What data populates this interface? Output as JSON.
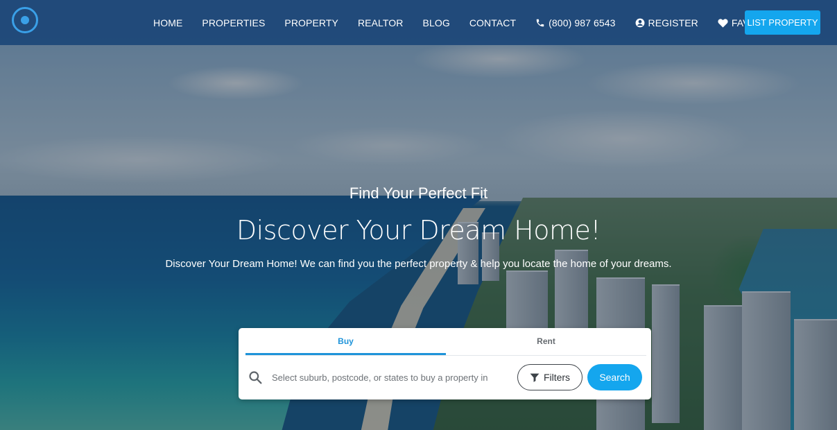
{
  "nav": {
    "items": [
      {
        "label": "HOME"
      },
      {
        "label": "PROPERTIES"
      },
      {
        "label": "PROPERTY"
      },
      {
        "label": "REALTOR"
      },
      {
        "label": "BLOG"
      },
      {
        "label": "CONTACT"
      }
    ],
    "phone": "(800) 987 6543",
    "register": "REGISTER",
    "favourites": "FAVOURITES",
    "list_property": "LIST PROPERTY"
  },
  "hero": {
    "tagline": "Find Your Perfect Fit",
    "headline": "Discover Your Dream Home!",
    "subtext": "Discover Your Dream Home! We can find you the perfect property & help you locate the home of your dreams."
  },
  "search": {
    "tabs": [
      {
        "label": "Buy",
        "active": true
      },
      {
        "label": "Rent",
        "active": false
      }
    ],
    "placeholder": "Select suburb, postcode, or states to buy a property in",
    "filters_label": "Filters",
    "search_label": "Search"
  },
  "colors": {
    "accent": "#14a6ee",
    "navbar": "#1c4678",
    "tab_active": "#1e93d9"
  },
  "icons": {
    "logo": "location-pin-logo",
    "phone": "phone-icon",
    "register": "user-circle-icon",
    "favourites": "heart-icon",
    "search": "search-icon",
    "filters": "filter-icon"
  }
}
